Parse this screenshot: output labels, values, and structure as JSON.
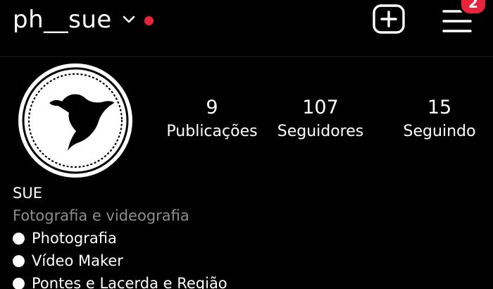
{
  "header": {
    "username": "ph__sue",
    "notification_dot_color": "#e8233a",
    "menu_badge_count": "2",
    "badge_color": "#e8233a",
    "icons": [
      "chevron-down-icon",
      "plus-square-icon",
      "menu-icon"
    ]
  },
  "profile": {
    "avatar_icon": "bird-icon",
    "stats": [
      {
        "value": "9",
        "label": "Publicações"
      },
      {
        "value": "107",
        "label": "Seguidores"
      },
      {
        "value": "15",
        "label": "Seguindo"
      }
    ]
  },
  "bio": {
    "name": "SUE",
    "category": "Fotografia e videografia",
    "lines": [
      "Photografia",
      "Vídeo Maker",
      "Pontes e Lacerda e Região"
    ]
  }
}
